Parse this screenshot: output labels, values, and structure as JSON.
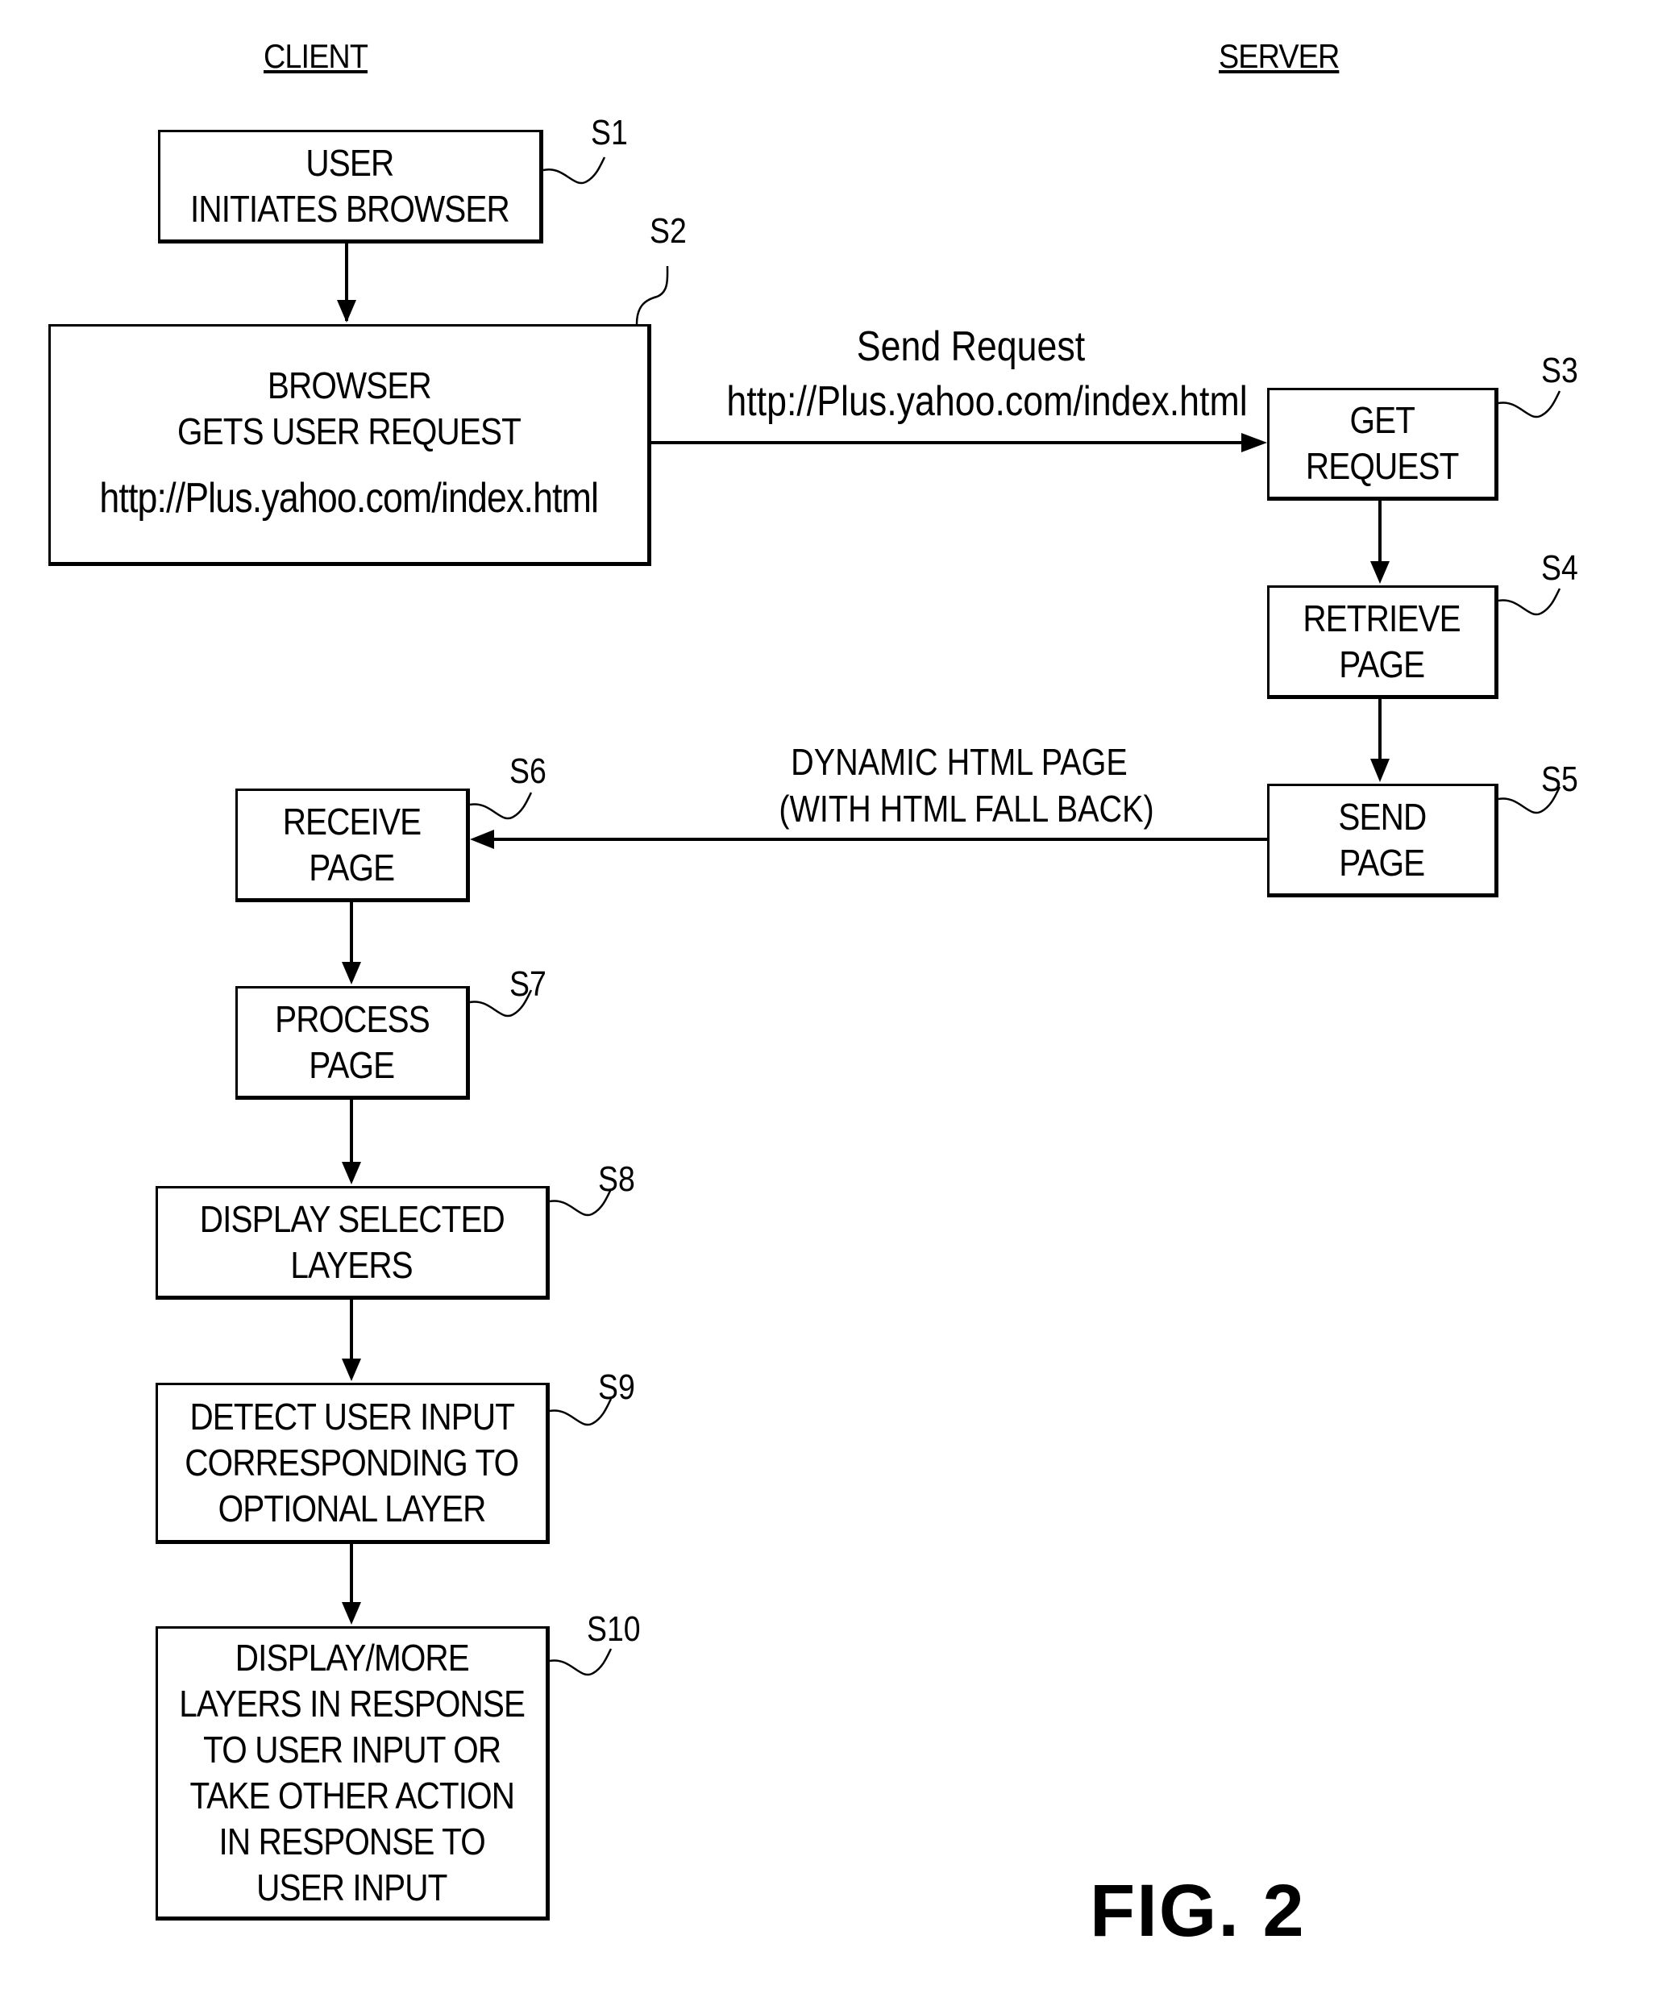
{
  "figure_label": "FIG. 2",
  "columns": {
    "client": "CLIENT",
    "server": "SERVER"
  },
  "steps": {
    "s1": {
      "id": "S1",
      "lines": [
        "USER",
        "INITIATES BROWSER"
      ]
    },
    "s2": {
      "id": "S2",
      "lines": [
        "BROWSER",
        "GETS USER REQUEST",
        "",
        "http://Plus.yahoo.com/index.html"
      ]
    },
    "s3": {
      "id": "S3",
      "lines": [
        "GET",
        "REQUEST"
      ]
    },
    "s4": {
      "id": "S4",
      "lines": [
        "RETRIEVE",
        "PAGE"
      ]
    },
    "s5": {
      "id": "S5",
      "lines": [
        "SEND",
        "PAGE"
      ]
    },
    "s6": {
      "id": "S6",
      "lines": [
        "RECEIVE",
        "PAGE"
      ]
    },
    "s7": {
      "id": "S7",
      "lines": [
        "PROCESS",
        "PAGE"
      ]
    },
    "s8": {
      "id": "S8",
      "lines": [
        "DISPLAY SELECTED",
        "LAYERS"
      ]
    },
    "s9": {
      "id": "S9",
      "lines": [
        "DETECT USER INPUT",
        "CORRESPONDING TO",
        "OPTIONAL LAYER"
      ]
    },
    "s10": {
      "id": "S10",
      "lines": [
        "DISPLAY/MORE",
        "LAYERS IN RESPONSE",
        "TO USER INPUT OR",
        "TAKE OTHER ACTION",
        "IN RESPONSE TO",
        "USER INPUT"
      ]
    }
  },
  "flows": {
    "request": {
      "lines": [
        "Send Request",
        "http://Plus.yahoo.com/index.html"
      ]
    },
    "response": {
      "lines": [
        "DYNAMIC HTML PAGE",
        "(WITH HTML FALL BACK)"
      ]
    }
  }
}
